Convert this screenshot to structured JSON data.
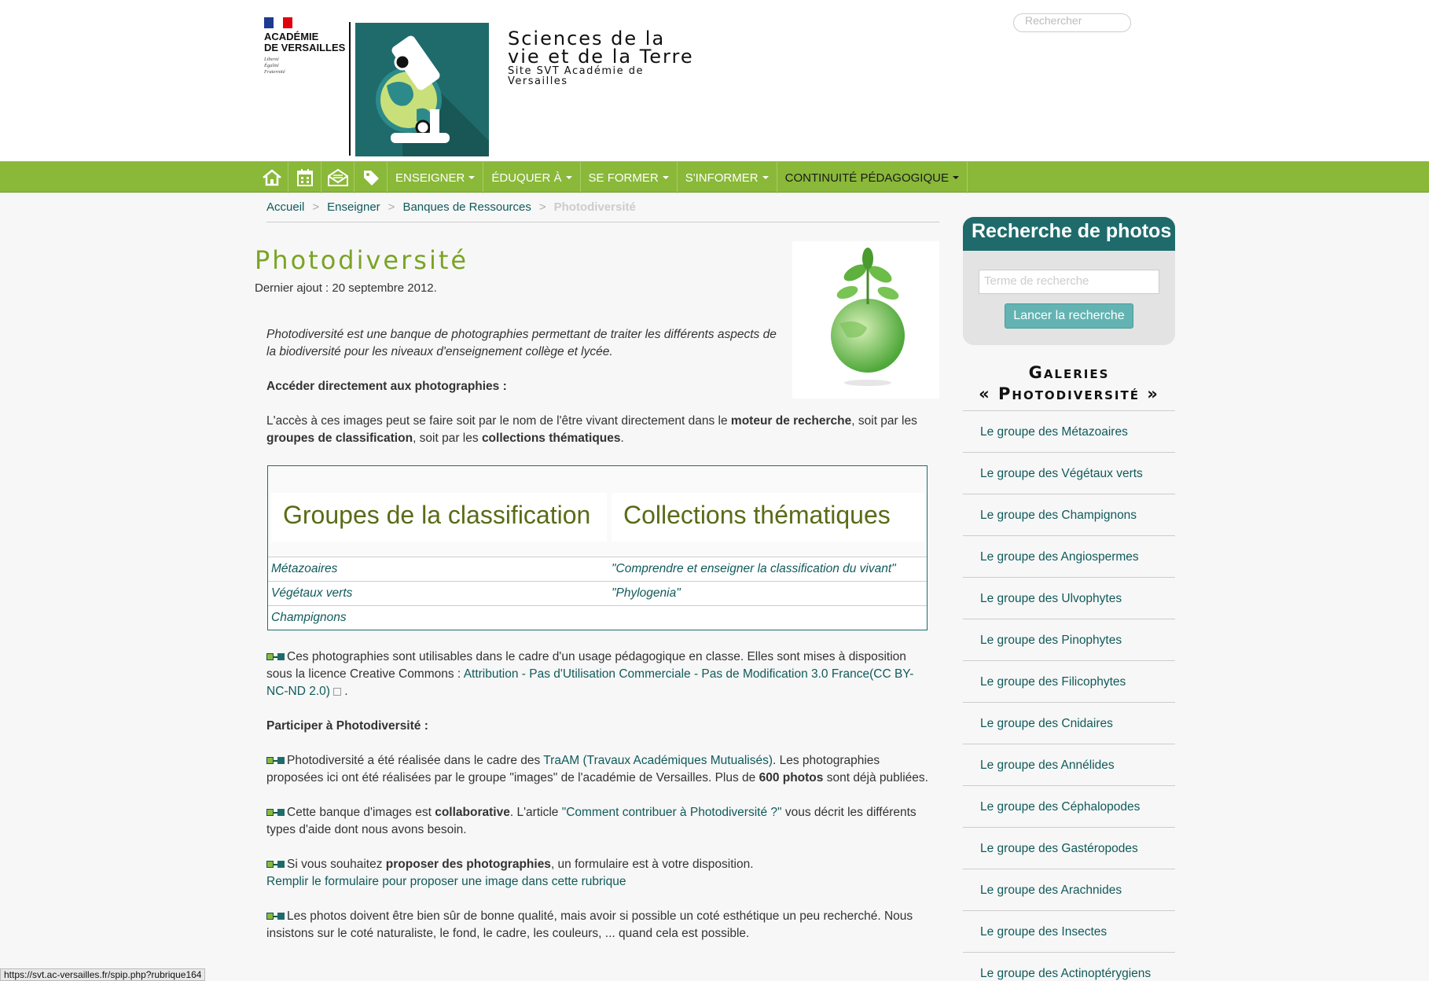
{
  "header": {
    "academie_name": "ACADÉMIE\nDE VERSAILLES",
    "academie_motto": "Liberté\nÉgalité\nFraternité",
    "site_title_line1": "Sciences de la",
    "site_title_line2": "vie et de la Terre",
    "site_subtitle": "Site SVT Académie de Versailles",
    "search_placeholder": "Rechercher"
  },
  "nav": {
    "icons": [
      "home-icon",
      "calendar-icon",
      "newsletter-icon",
      "tag-icon"
    ],
    "items": [
      {
        "label": "ENSEIGNER"
      },
      {
        "label": "ÉDUQUER À"
      },
      {
        "label": "SE FORMER"
      },
      {
        "label": "S'INFORMER"
      },
      {
        "label": "CONTINUITÉ PÉDAGOGIQUE"
      }
    ],
    "color": "#8ab839"
  },
  "breadcrumb": {
    "items": [
      "Accueil",
      "Enseigner",
      "Banques de Ressources"
    ],
    "current": "Photodiversité",
    "separator": ">"
  },
  "main": {
    "title": "Photodiversité",
    "date": "Dernier ajout : 20 septembre 2012.",
    "intro": "Photodiversité est une banque de photographies permettant de traiter les différents aspects de la biodiversité pour les niveaux d'enseignement collège et lycée.",
    "access_heading": "Accéder directement aux photographies :",
    "access_text_1": "L'accès à ces images peut se faire soit par le nom de l'être vivant directement dans le ",
    "access_bold_1": "moteur de recherche",
    "access_text_2": ", soit par les ",
    "access_bold_2": "groupes de classification",
    "access_text_3": ", soit par les ",
    "access_bold_3": "collections thématiques",
    "access_text_4": ".",
    "table": {
      "headers": [
        "Groupes de la classification",
        "Collections thématiques"
      ],
      "rows": [
        [
          "Métazoaires",
          "\"Comprendre et enseigner la classification du vivant\""
        ],
        [
          "Végétaux verts",
          "\"Phylogenia\""
        ],
        [
          "Champignons",
          ""
        ]
      ]
    },
    "license_text": "Ces photographies sont utilisables dans le cadre d'un usage pédagogique en classe. Elles sont mises à disposition sous la licence Creative Commons : ",
    "license_link": "Attribution - Pas d'Utilisation Commerciale - Pas de Modification 3.0 France(CC BY-NC-ND 2.0)",
    "license_end": " .",
    "participer_heading": "Participer à Photodiversité :",
    "traam_text_1": "Photodiversité a été réalisée dans le cadre des ",
    "traam_link": "TraAM (Travaux Académiques Mutualisés)",
    "traam_text_2": ". Les photographies proposées ici ont été réalisées par le groupe \"images\" de l'académie de Versailles. Plus de ",
    "traam_bold": "600 photos",
    "traam_text_3": " sont déjà publiées.",
    "collab_text_1": "Cette banque d'images est ",
    "collab_bold": "collaborative",
    "collab_text_2": ". L'article ",
    "collab_link": "\"Comment contribuer à Photodiversité ?\"",
    "collab_text_3": " vous décrit les différents types d'aide dont nous avons besoin.",
    "propose_text_1": "Si vous souhaitez ",
    "propose_bold": "proposer des photographies",
    "propose_text_2": ", un formulaire est à votre disposition.",
    "propose_link": "Remplir le formulaire pour proposer une image dans cette rubrique",
    "quality_text": "Les photos doivent être bien sûr de bonne qualité, mais avoir si possible un coté esthétique un peu recherché. Nous insistons sur le coté naturaliste, le fond, le cadre, les couleurs, ... quand cela est possible."
  },
  "sidebar": {
    "search_title": "Recherche de photos",
    "search_placeholder": "Terme de recherche",
    "search_button": "Lancer la recherche",
    "gallery_title_1": "Galeries",
    "gallery_title_2": "« Photodiversité »",
    "gallery_items": [
      "Le groupe des Métazoaires",
      "Le groupe des Végétaux verts",
      "Le groupe des Champignons",
      "Le groupe des Angiospermes",
      "Le groupe des Ulvophytes",
      "Le groupe des Pinophytes",
      "Le groupe des Filicophytes",
      "Le groupe des Cnidaires",
      "Le groupe des Annélides",
      "Le groupe des Céphalopodes",
      "Le groupe des Gastéropodes",
      "Le groupe des Arachnides",
      "Le groupe des Insectes",
      "Le groupe des Actinoptérygiens"
    ]
  },
  "status_bar": {
    "url": "https://svt.ac-versailles.fr/spip.php?rubrique164"
  },
  "colors": {
    "accent_green": "#7aa425",
    "teal": "#1f6b6b",
    "link": "#115a5a"
  }
}
